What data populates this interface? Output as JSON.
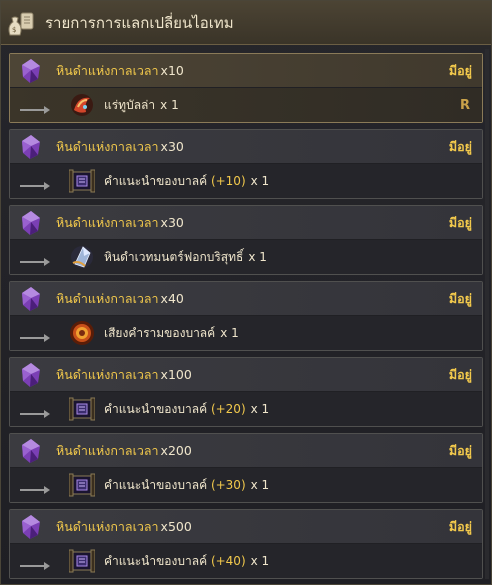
{
  "window": {
    "title": "รายการการแลกเปลี่ยนไอเทม"
  },
  "colors": {
    "gold": "#f2c94c",
    "cream": "#f0e6cc"
  },
  "entries": [
    {
      "req_name": "หินดำแห่งกาลเวลา",
      "req_qty": "x10",
      "status": "มีอยู่",
      "reward_icon": "ore-icon",
      "reward_name": "แร่ทูบัลล่า",
      "reward_plus": "",
      "reward_qty": "x 1",
      "tag": "R",
      "highlight": true
    },
    {
      "req_name": "หินดำแห่งกาลเวลา",
      "req_qty": "x30",
      "status": "มีอยู่",
      "reward_icon": "scroll-icon",
      "reward_name": "คำแนะนำของบาลค์",
      "reward_plus": "(+10)",
      "reward_qty": "x 1",
      "tag": ""
    },
    {
      "req_name": "หินดำแห่งกาลเวลา",
      "req_qty": "x30",
      "status": "มีอยู่",
      "reward_icon": "crystal-icon",
      "reward_name": "หินดำเวทมนตร์ฟอกบริสุทธิ์",
      "reward_plus": "",
      "reward_qty": "x 1",
      "tag": ""
    },
    {
      "req_name": "หินดำแห่งกาลเวลา",
      "req_qty": "x40",
      "status": "มีอยู่",
      "reward_icon": "fire-orb-icon",
      "reward_name": "เสียงคำรามของบาลค์",
      "reward_plus": "",
      "reward_qty": "x 1",
      "tag": ""
    },
    {
      "req_name": "หินดำแห่งกาลเวลา",
      "req_qty": "x100",
      "status": "มีอยู่",
      "reward_icon": "scroll-icon",
      "reward_name": "คำแนะนำของบาลค์",
      "reward_plus": "(+20)",
      "reward_qty": "x 1",
      "tag": ""
    },
    {
      "req_name": "หินดำแห่งกาลเวลา",
      "req_qty": "x200",
      "status": "มีอยู่",
      "reward_icon": "scroll-icon",
      "reward_name": "คำแนะนำของบาลค์",
      "reward_plus": "(+30)",
      "reward_qty": "x 1",
      "tag": ""
    },
    {
      "req_name": "หินดำแห่งกาลเวลา",
      "req_qty": "x500",
      "status": "มีอยู่",
      "reward_icon": "scroll-icon",
      "reward_name": "คำแนะนำของบาลค์",
      "reward_plus": "(+40)",
      "reward_qty": "x 1",
      "tag": ""
    }
  ]
}
